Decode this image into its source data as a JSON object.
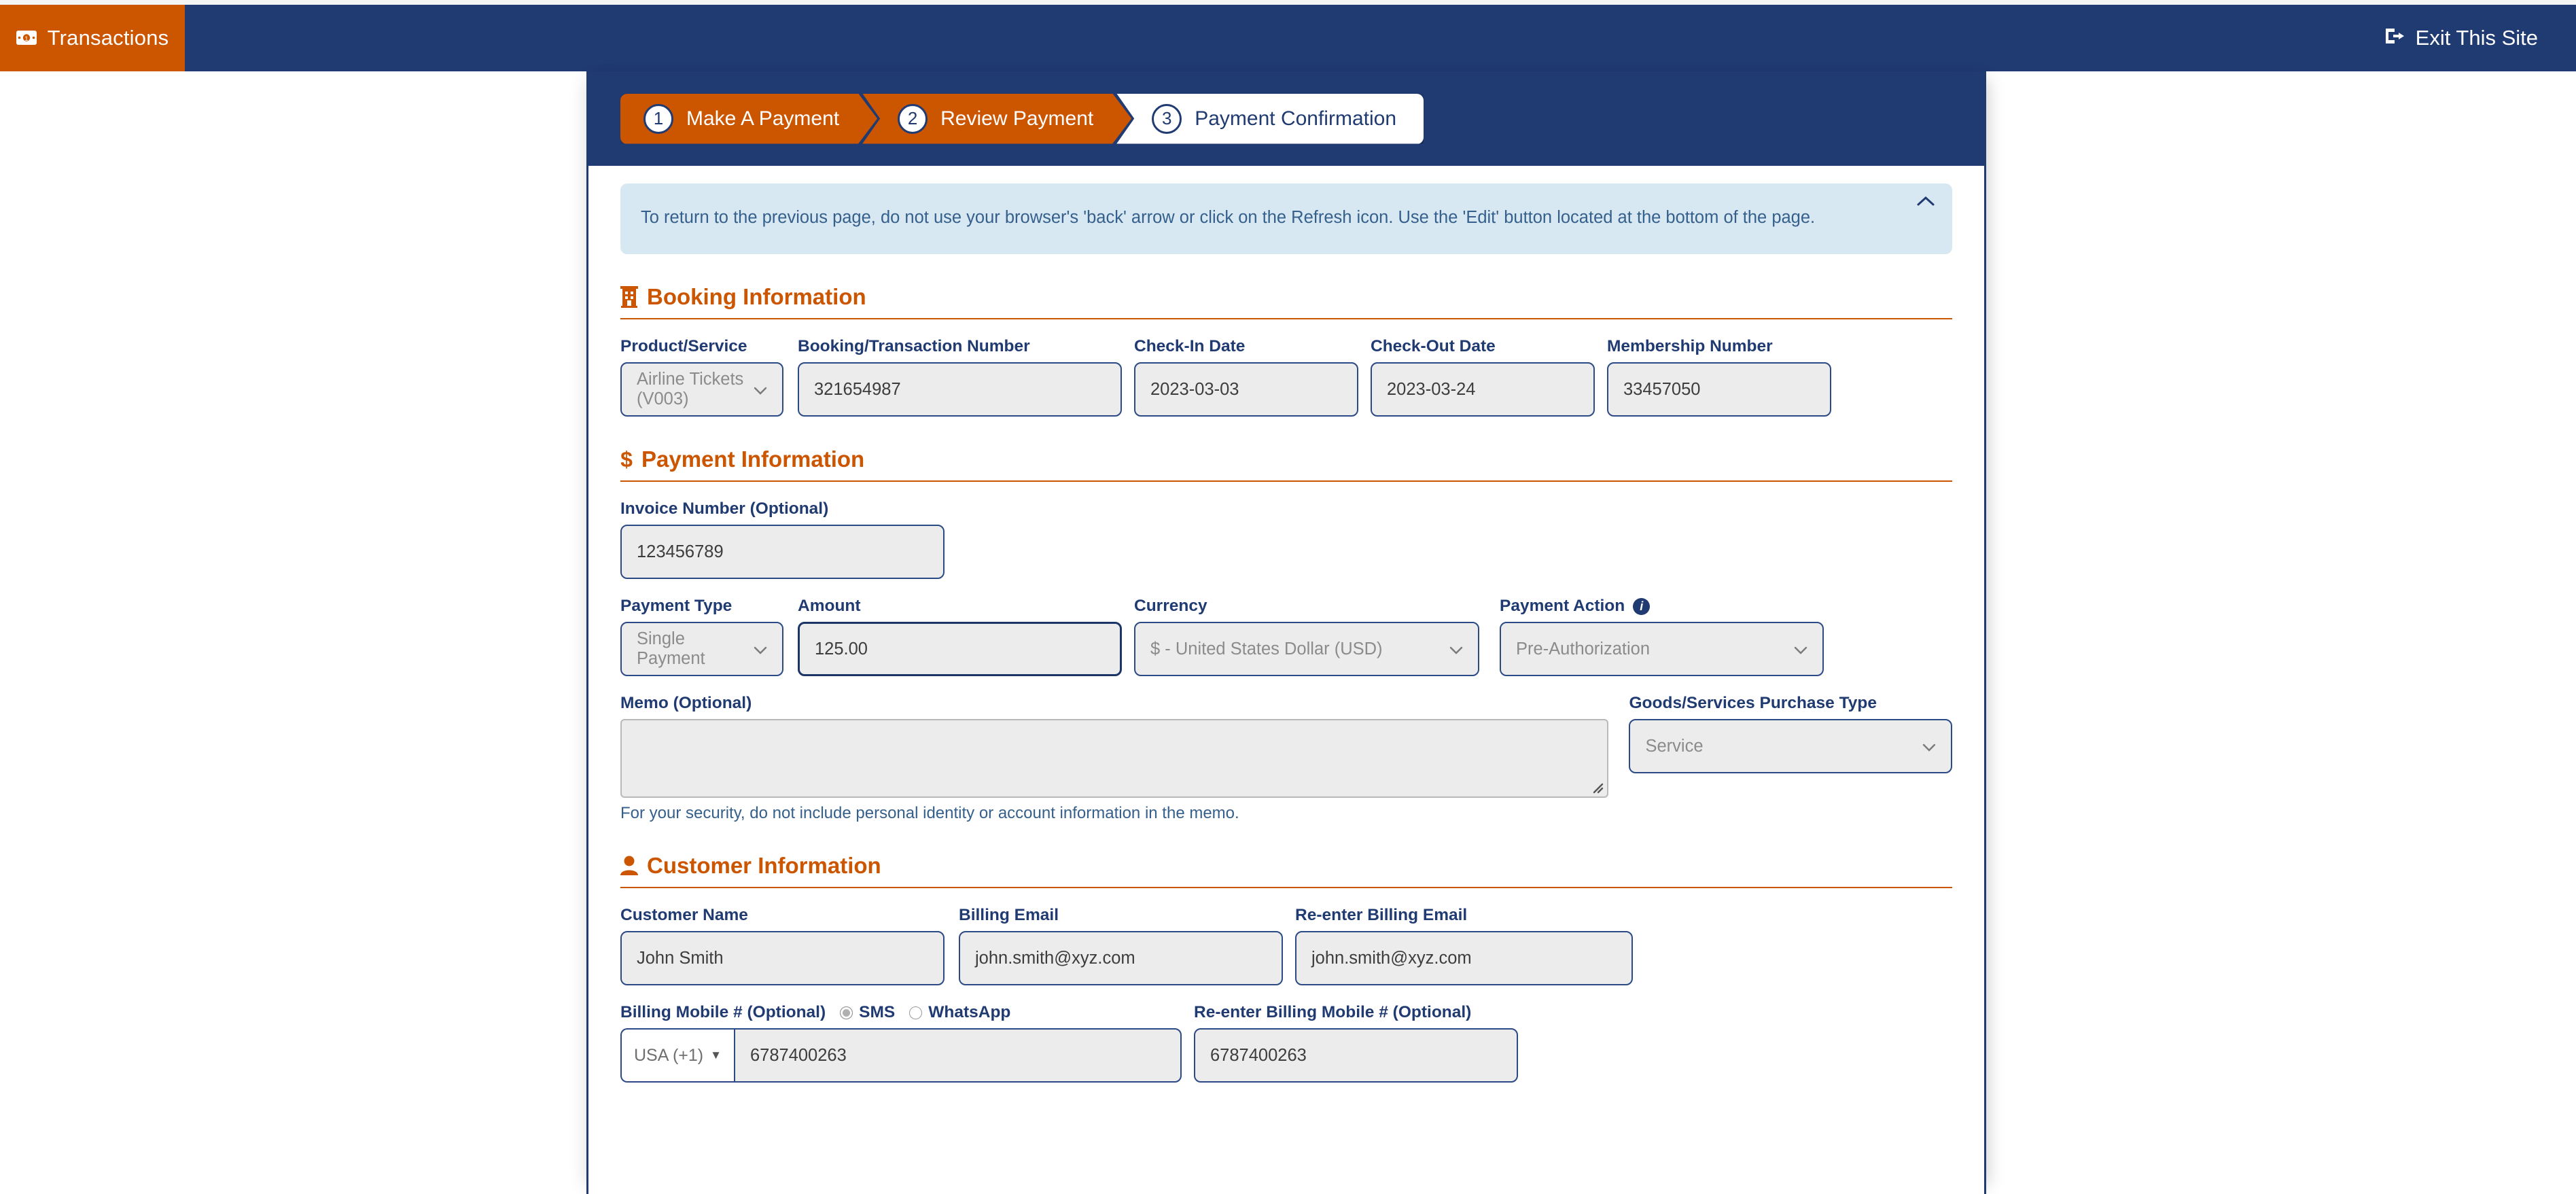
{
  "topbar": {
    "brand_label": "Transactions",
    "brand_icon": "money-bill-icon",
    "exit_label": "Exit This Site",
    "exit_icon": "sign-out-icon",
    "bg_color": "#203a72",
    "brand_bg_color": "#cc5500"
  },
  "wizard": {
    "steps": [
      {
        "num": "1",
        "label": "Make A Payment",
        "state": "complete"
      },
      {
        "num": "2",
        "label": "Review Payment",
        "state": "active"
      },
      {
        "num": "3",
        "label": "Payment Confirmation",
        "state": "inactive"
      }
    ]
  },
  "notice": {
    "text": "To return to the previous page, do not use your browser's 'back' arrow or click on the Refresh icon. Use the 'Edit' button located at the bottom of the page.",
    "collapse_icon": "chevron-up-icon",
    "bg_color": "#d8e8f3",
    "text_color": "#35608c"
  },
  "sections": {
    "booking": {
      "title": "Booking Information",
      "icon": "hotel-building-icon",
      "fields": {
        "product_service": {
          "label": "Product/Service",
          "value": "Airline Tickets (V003)",
          "type": "select"
        },
        "booking_number": {
          "label": "Booking/Transaction Number",
          "value": "321654987",
          "type": "input"
        },
        "check_in": {
          "label": "Check-In Date",
          "value": "2023-03-03",
          "type": "input"
        },
        "check_out": {
          "label": "Check-Out Date",
          "value": "2023-03-24",
          "type": "input"
        },
        "membership": {
          "label": "Membership Number",
          "value": "33457050",
          "type": "input"
        }
      }
    },
    "payment": {
      "title": "Payment Information",
      "icon": "dollar-sign-icon",
      "fields": {
        "invoice": {
          "label": "Invoice Number (Optional)",
          "value": "123456789",
          "type": "input"
        },
        "payment_type": {
          "label": "Payment Type",
          "value": "Single Payment",
          "type": "select"
        },
        "amount": {
          "label": "Amount",
          "value": "125.00",
          "type": "input"
        },
        "currency": {
          "label": "Currency",
          "value": "$ - United States Dollar (USD)",
          "type": "select"
        },
        "payment_action": {
          "label": "Payment Action",
          "value": "Pre-Authorization",
          "type": "select",
          "info_icon": "info-circle-icon"
        },
        "memo": {
          "label": "Memo (Optional)",
          "value": "",
          "type": "textarea",
          "helper": "For your security, do not include personal identity or account information in the memo."
        },
        "purchase_type": {
          "label": "Goods/Services Purchase Type",
          "value": "Service",
          "type": "select"
        }
      }
    },
    "customer": {
      "title": "Customer Information",
      "icon": "user-icon",
      "fields": {
        "customer_name": {
          "label": "Customer Name",
          "value": "John Smith",
          "type": "input"
        },
        "billing_email": {
          "label": "Billing Email",
          "value": "john.smith@xyz.com",
          "type": "input"
        },
        "reenter_billing_email": {
          "label": "Re-enter Billing Email",
          "value": "john.smith@xyz.com",
          "type": "input"
        },
        "billing_mobile": {
          "label": "Billing Mobile # (Optional)",
          "country_code": "USA (+1)",
          "value": "6787400263",
          "channel_options": [
            {
              "label": "SMS",
              "selected": true
            },
            {
              "label": "WhatsApp",
              "selected": false
            }
          ]
        },
        "reenter_billing_mobile": {
          "label": "Re-enter Billing Mobile # (Optional)",
          "value": "6787400263",
          "type": "input"
        }
      }
    }
  },
  "theme": {
    "accent_orange": "#cc5500",
    "navy": "#203a72",
    "field_bg": "#ececec",
    "field_border": "#2b4a86"
  }
}
